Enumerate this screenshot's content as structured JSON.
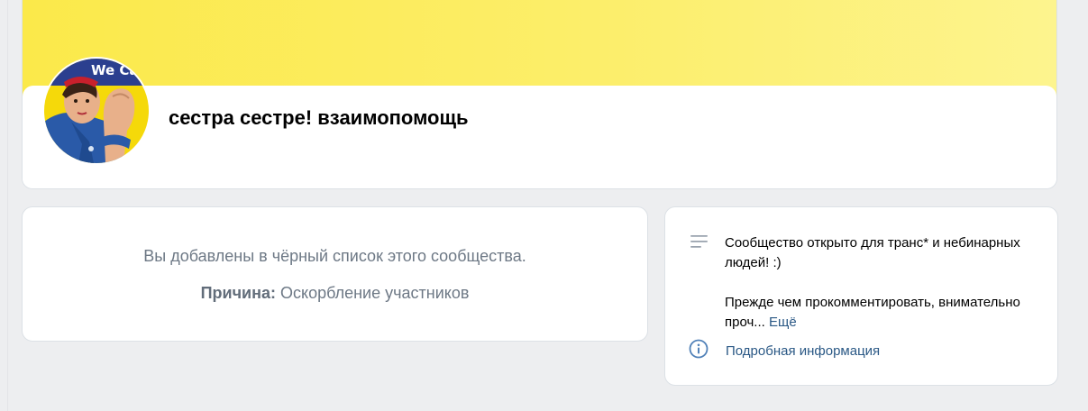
{
  "group": {
    "title": "сестра сестре! взаимопомощь"
  },
  "blacklist": {
    "message": "Вы добавлены в чёрный список этого сообщества.",
    "reason_label": "Причина:",
    "reason_value": "Оскорбление участников"
  },
  "info": {
    "description_p1": "Сообщество открыто для транс* и небинарных людей! :)",
    "description_p2": "Прежде чем прокомментировать, внимательно проч...",
    "more_label": "Ещё",
    "details_label": "Подробная информация"
  },
  "colors": {
    "cover": "#fbe94a",
    "link": "#2a5885",
    "muted_text": "#6d7885",
    "background": "#edeef0"
  },
  "icons": {
    "description": "lines-icon",
    "details": "info-circle-icon"
  }
}
